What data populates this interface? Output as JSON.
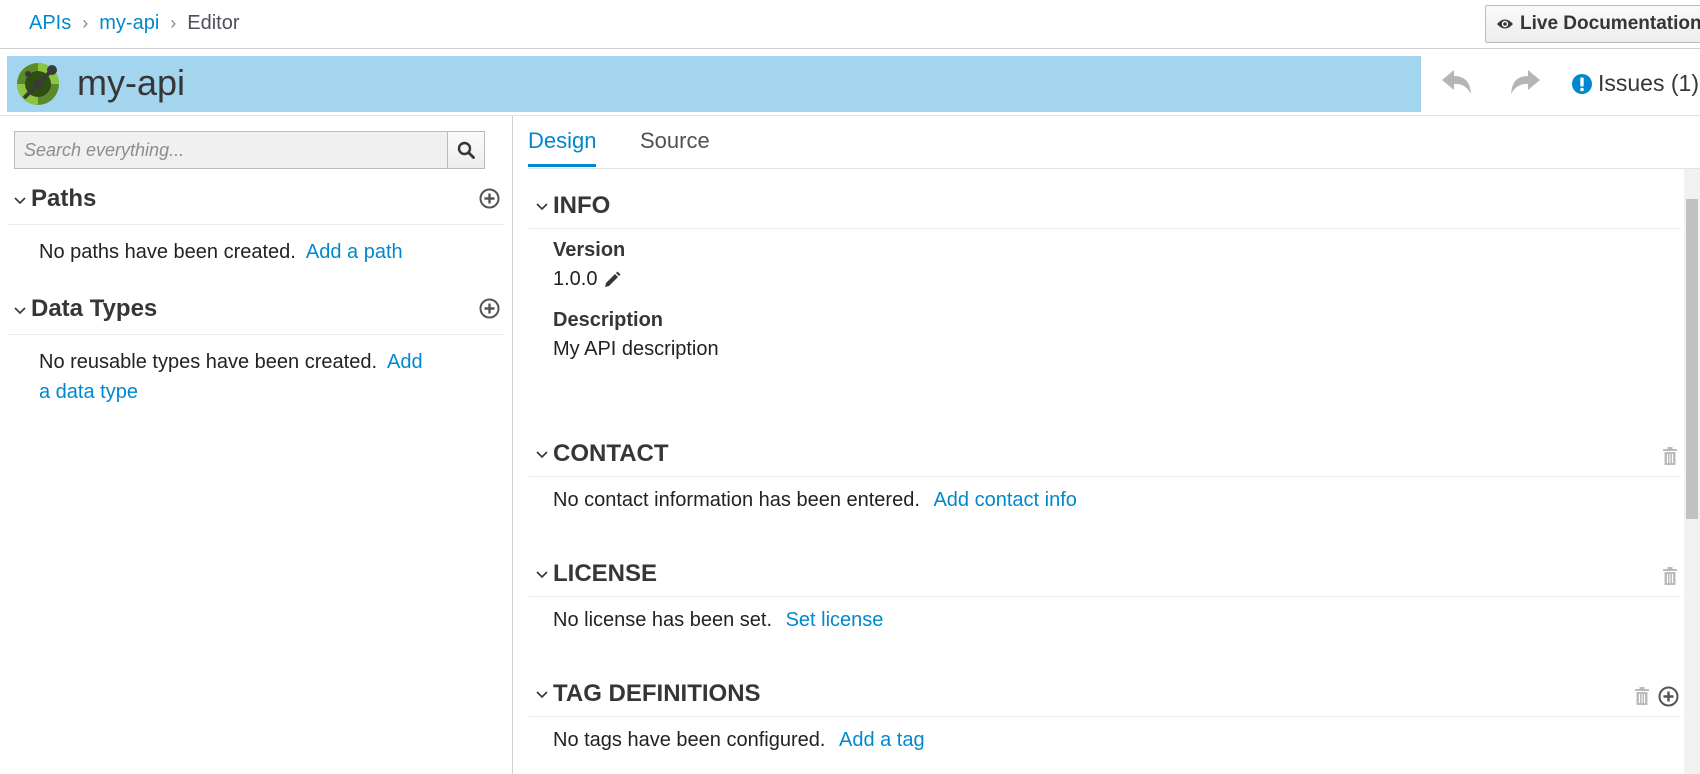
{
  "breadcrumb": {
    "apis": "APIs",
    "api": "my-api",
    "current": "Editor",
    "separator": "›"
  },
  "header": {
    "live_doc_label": "Live Documentation",
    "api_title": "my-api",
    "issues_label": "Issues (1)"
  },
  "search": {
    "placeholder": "Search everything..."
  },
  "left_panel": {
    "paths": {
      "title": "Paths",
      "empty_text": "No paths have been created.",
      "add_link": "Add a path"
    },
    "data_types": {
      "title": "Data Types",
      "empty_text": "No reusable types have been created.",
      "add_link": "Add a data type"
    }
  },
  "tabs": {
    "design": "Design",
    "source": "Source"
  },
  "info": {
    "title": "INFO",
    "version_label": "Version",
    "version_value": "1.0.0",
    "description_label": "Description",
    "description_value": "My API description"
  },
  "contact": {
    "title": "CONTACT",
    "empty_text": "No contact information has been entered.",
    "add_link": "Add contact info"
  },
  "license": {
    "title": "LICENSE",
    "empty_text": "No license has been set.",
    "add_link": "Set license"
  },
  "tags": {
    "title": "TAG DEFINITIONS",
    "empty_text": "No tags have been configured.",
    "add_link": "Add a tag"
  },
  "colors": {
    "accent": "#0088ce",
    "title_bar": "#a4d5ee",
    "issue_icon": "#0088ce"
  },
  "icons": [
    "eye-icon",
    "logo-icon",
    "undo-icon",
    "redo-icon",
    "exclamation-icon",
    "search-icon",
    "chevron-down-icon",
    "add-circle-icon",
    "pencil-icon",
    "trash-icon"
  ]
}
